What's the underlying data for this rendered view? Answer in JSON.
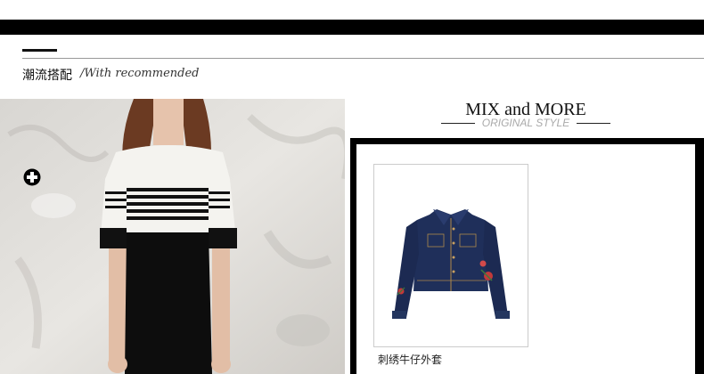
{
  "section": {
    "title": "潮流搭配",
    "subtitle": "/With recommended"
  },
  "mix": {
    "title": "MIX and MORE",
    "subtitle": "ORIGINAL STYLE"
  },
  "product": {
    "name": "刺绣牛仔外套",
    "icon": "plus-circle-icon"
  },
  "colors": {
    "black": "#000000",
    "rule": "#999999",
    "subtitle_gray": "#aaaaaa",
    "denim": "#1f2f5a"
  }
}
